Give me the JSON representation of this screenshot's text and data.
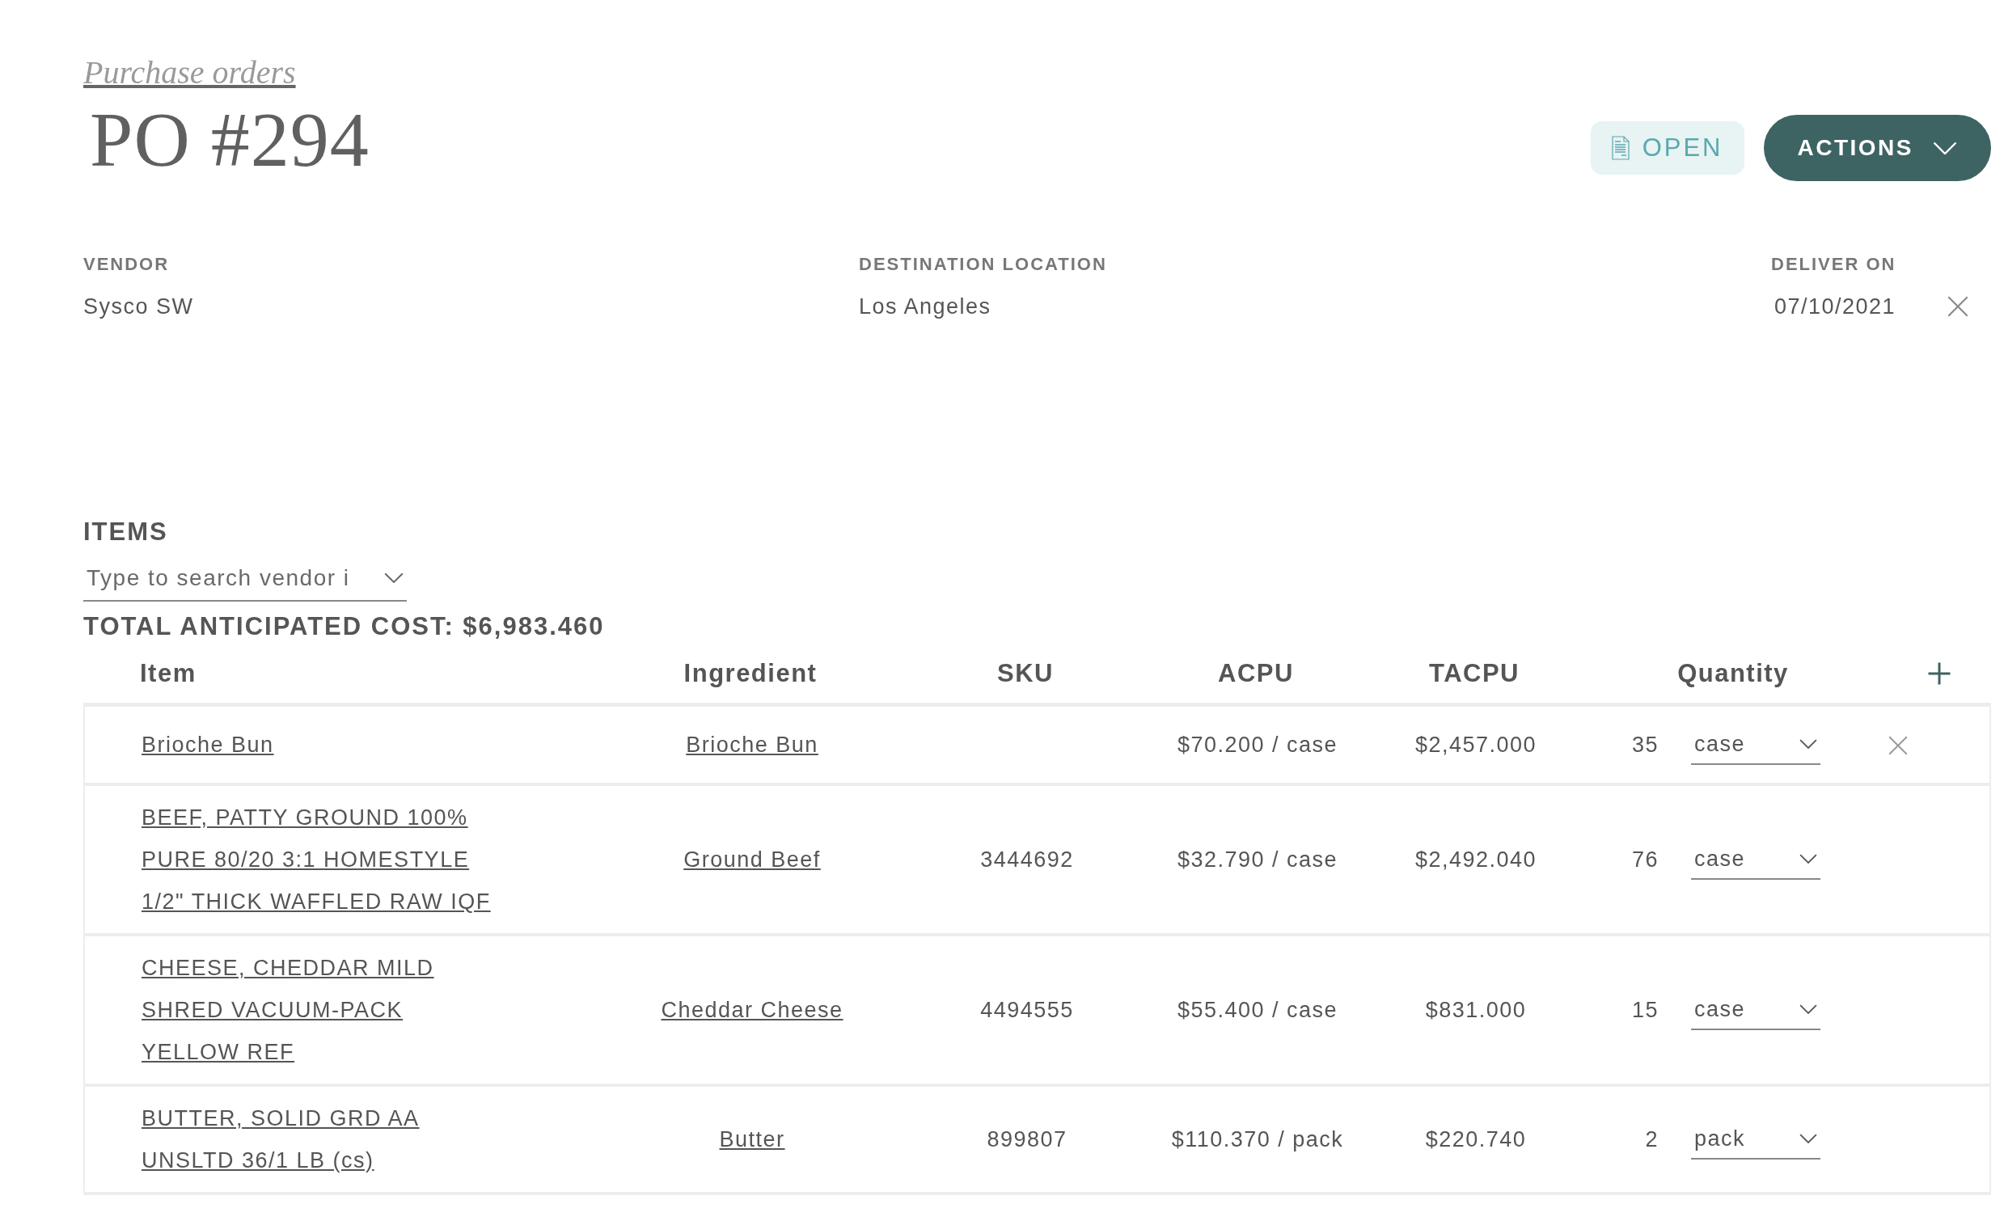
{
  "breadcrumb": "Purchase orders",
  "title": "PO #294",
  "status": {
    "label": "OPEN"
  },
  "actions_button": {
    "label": "ACTIONS"
  },
  "fields": [
    {
      "label": "VENDOR",
      "value": "Sysco SW",
      "clearable": false
    },
    {
      "label": "DESTINATION LOCATION",
      "value": "Los Angeles",
      "clearable": false
    },
    {
      "label": "DELIVER ON",
      "value": "07/10/2021",
      "clearable": true
    }
  ],
  "items_section": {
    "heading": "ITEMS",
    "search": {
      "value": "Type to search vendor i"
    },
    "total": "TOTAL ANTICIPATED COST: $6,983.460"
  },
  "table": {
    "columns": [
      "Item",
      "Ingredient",
      "SKU",
      "ACPU",
      "TACPU",
      "Quantity"
    ],
    "rows": [
      {
        "item": "Brioche Bun",
        "ingredient": "Brioche Bun",
        "acpu": "$70.200 / case",
        "tacpu": "$2,457.000",
        "quantity": "35",
        "unit": "case",
        "removable": true
      },
      {
        "item": "BEEF, PATTY GROUND 100% PURE 80/20 3:1 HOMESTYLE 1/2\" THICK WAFFLED RAW IQF",
        "ingredient": "Ground Beef",
        "sku": "3444692",
        "acpu": "$32.790 / case",
        "tacpu": "$2,492.040",
        "quantity": "76",
        "unit": "case",
        "removable": false
      },
      {
        "item": "CHEESE, CHEDDAR MILD SHRED VACUUM-PACK YELLOW REF",
        "ingredient": "Cheddar Cheese",
        "sku": "4494555",
        "acpu": "$55.400 / case",
        "tacpu": "$831.000",
        "quantity": "15",
        "unit": "case",
        "removable": false
      },
      {
        "item": "BUTTER, SOLID GRD AA UNSLTD 36/1 LB (cs)",
        "ingredient": "Butter",
        "sku": "899807",
        "acpu": "$110.370 / pack",
        "tacpu": "$220.740",
        "quantity": "2",
        "unit": "pack",
        "removable": false
      }
    ]
  }
}
